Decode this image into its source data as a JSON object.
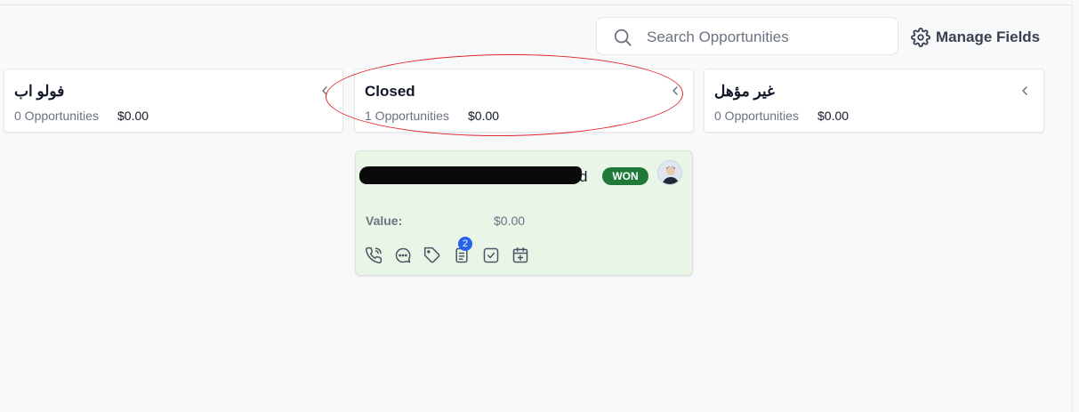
{
  "search": {
    "placeholder": "Search Opportunities",
    "value": ""
  },
  "header": {
    "manage_fields_label": "Manage Fields"
  },
  "columns": [
    {
      "title": "فولو اب",
      "count_label": "0 Opportunities",
      "amount": "$0.00"
    },
    {
      "title": "Closed",
      "count_label": "1 Opportunities",
      "amount": "$0.00"
    },
    {
      "title": "غير مؤهل",
      "count_label": "0 Opportunities",
      "amount": "$0.00"
    }
  ],
  "card": {
    "name_tail": "d",
    "status": "WON",
    "value_label": "Value:",
    "value": "$0.00",
    "notes_count": "2",
    "icons": [
      "phone-icon",
      "chat-icon",
      "tag-icon",
      "notes-icon",
      "task-icon",
      "calendar-add-icon"
    ]
  },
  "colors": {
    "won_badge": "#1f7a3a",
    "card_background": "#e8f5e7",
    "annotation_ellipse": "#e0262b",
    "notes_badge": "#2563eb"
  }
}
